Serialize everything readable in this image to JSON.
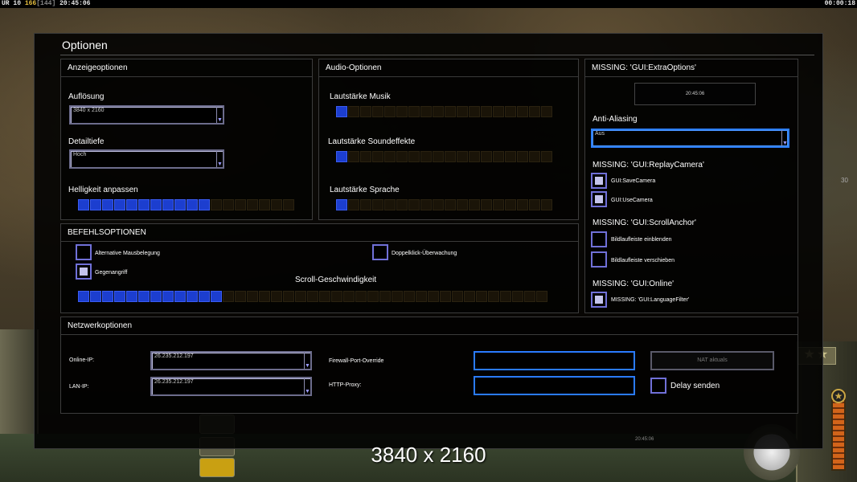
{
  "status_bar": {
    "prefix": "UR 10",
    "value_yellow": "166",
    "value_gray": "[144]",
    "time_left": "20:45:06",
    "time_right": "00:00:18"
  },
  "dialog": {
    "title": "Optionen"
  },
  "display": {
    "heading": "Anzeigeoptionen",
    "resolution_label": "Auflösung",
    "resolution_value": "3840 x 2160",
    "detail_label": "Detailtiefe",
    "detail_value": "Hoch",
    "brightness_label": "Helligkeit anpassen",
    "brightness_level": 0.6
  },
  "audio": {
    "heading": "Audio-Optionen",
    "music_label": "Lautstärke Musik",
    "music_level": 0.05,
    "sfx_label": "Lautstärke Soundeffekte",
    "sfx_level": 0.05,
    "speech_label": "Lautstärke Sprache",
    "speech_level": 0.05
  },
  "extra": {
    "heading": "MISSING: 'GUI:ExtraOptions'",
    "clock": "20:45:06",
    "aa_label": "Anti-Aliasing",
    "aa_value": "Aus",
    "replay_heading": "MISSING: 'GUI:ReplayCamera'",
    "save_camera": "GUI:SaveCamera",
    "use_camera": "GUI:UseCamera",
    "scroll_heading": "MISSING: 'GUI:ScrollAnchor'",
    "show_bar": "Bildlaufleiste einblenden",
    "move_bar": "Bildlaufleiste verschieben",
    "online_heading": "MISSING: 'GUI:Online'",
    "language_filter": "MISSING: 'GUI:LanguageFilter'"
  },
  "command": {
    "heading": "BEFEHLSOPTIONEN",
    "alt_mouse": "Alternative Mausbelegung",
    "double_click": "Doppelklick-Überwachung",
    "counter_attack": "Gegenangriff",
    "scroll_speed_label": "Scroll-Geschwindigkeit",
    "scroll_speed_level": 0.3
  },
  "network": {
    "heading": "Netzwerkoptionen",
    "online_ip_label": "Online-IP:",
    "online_ip_value": "26.235.212.197",
    "lan_ip_label": "LAN-IP:",
    "lan_ip_value": "26.235.212.197",
    "firewall_label": "Firewall-Port-Override",
    "proxy_label": "HTTP-Proxy:",
    "nat_button": "NAT aktuals",
    "delay_label": "Delay senden"
  },
  "overlay": {
    "resolution_text": "3840 x 2160",
    "tiny_clock": "20:45:06",
    "side_text": "30"
  },
  "hud": {
    "stars": "★★"
  }
}
